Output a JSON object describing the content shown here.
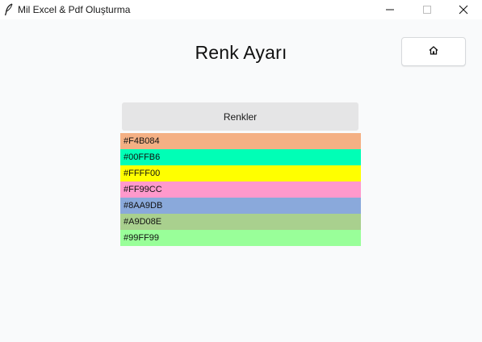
{
  "window": {
    "title": "Mil Excel & Pdf Oluşturma",
    "app_icon": "feather-icon",
    "controls": [
      "minimize-icon",
      "maximize-icon",
      "close-icon"
    ]
  },
  "page": {
    "title": "Renk Ayarı",
    "home_icon": "house-icon"
  },
  "colors_header": {
    "label": "Renkler"
  },
  "colors": [
    {
      "label": "#F4B084",
      "color": "#F4B084"
    },
    {
      "label": "#00FFB6",
      "color": "#00FFB6"
    },
    {
      "label": "#FFFF00",
      "color": "#FFFF00"
    },
    {
      "label": "#FF99CC",
      "color": "#FF99CC"
    },
    {
      "label": "#8AA9DB",
      "color": "#8AA9DB"
    },
    {
      "label": "#A9D08E",
      "color": "#A9D08E"
    },
    {
      "label": "#99FF99",
      "color": "#99FF99"
    }
  ]
}
